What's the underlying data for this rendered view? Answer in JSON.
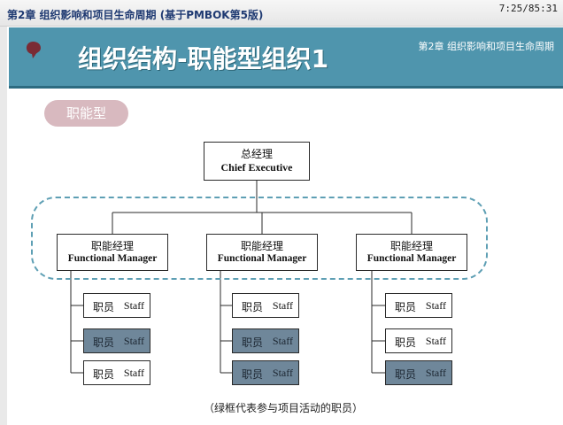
{
  "window": {
    "course_title": "第2章 组织影响和项目生命周期 (基于PMBOK第5版)",
    "timer": "7:25/85:31"
  },
  "header": {
    "title": "组织结构-职能型组织1",
    "chapter_ref": "第2章 组织影响和项目生命周期"
  },
  "type_label": "职能型",
  "org_chart": {
    "ceo": {
      "cn": "总经理",
      "en": "Chief Executive"
    },
    "managers": [
      {
        "cn": "职能经理",
        "en": "Functional Manager",
        "staff": [
          {
            "cn": "职员",
            "en": "Staff",
            "in_project": false
          },
          {
            "cn": "职员",
            "en": "Staff",
            "in_project": true
          },
          {
            "cn": "职员",
            "en": "Staff",
            "in_project": false
          }
        ]
      },
      {
        "cn": "职能经理",
        "en": "Functional Manager",
        "staff": [
          {
            "cn": "职员",
            "en": "Staff",
            "in_project": false
          },
          {
            "cn": "职员",
            "en": "Staff",
            "in_project": true
          },
          {
            "cn": "职员",
            "en": "Staff",
            "in_project": true
          }
        ]
      },
      {
        "cn": "职能经理",
        "en": "Functional Manager",
        "staff": [
          {
            "cn": "职员",
            "en": "Staff",
            "in_project": false
          },
          {
            "cn": "职员",
            "en": "Staff",
            "in_project": false
          },
          {
            "cn": "职员",
            "en": "Staff",
            "in_project": true
          }
        ]
      }
    ]
  },
  "footnote": "（绿框代表参与项目活动的职员）",
  "colors": {
    "banner": "#4f95ad",
    "dashed_border": "#5e9fb4",
    "active_staff_fill": "#6f879a",
    "pill": "#d8b9bf"
  }
}
